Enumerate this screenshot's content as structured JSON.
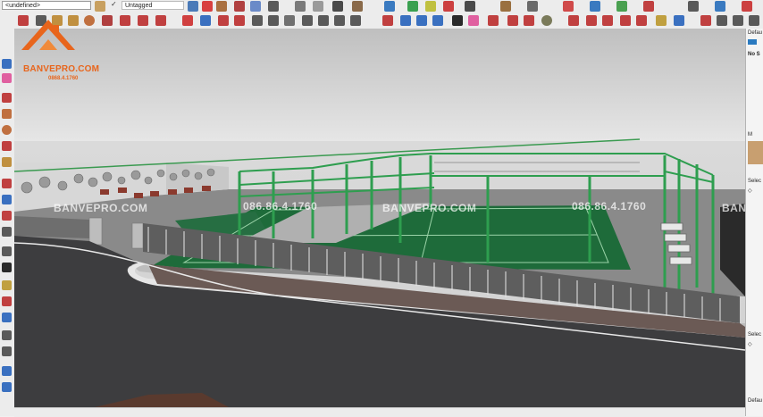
{
  "toolbar": {
    "layer_name": "<undefined>",
    "tag_name": "Untagged",
    "tag_check": "✓"
  },
  "brand": {
    "name": "BANVEPRO.COM",
    "phone": "0868.4.1760"
  },
  "watermarks": [
    "BANVEPRO.COM",
    "086.86.4.1760",
    "BANVEPRO.COM",
    "086.86.4.1760",
    "BANVE"
  ],
  "right_panel": {
    "tray_title": "Defau",
    "no_selection": "No S",
    "materials_header": "M",
    "select_1": "Selec",
    "select_2": "Selec",
    "default_bottom": "Defau"
  },
  "colors": {
    "court": "#1e6b3a",
    "steel": "#2e9e4f",
    "asphalt": "#3d3d3f",
    "sidewalk": "#6b5a55",
    "sky": "#d8d8d8",
    "accent_orange": "#e8651c"
  }
}
